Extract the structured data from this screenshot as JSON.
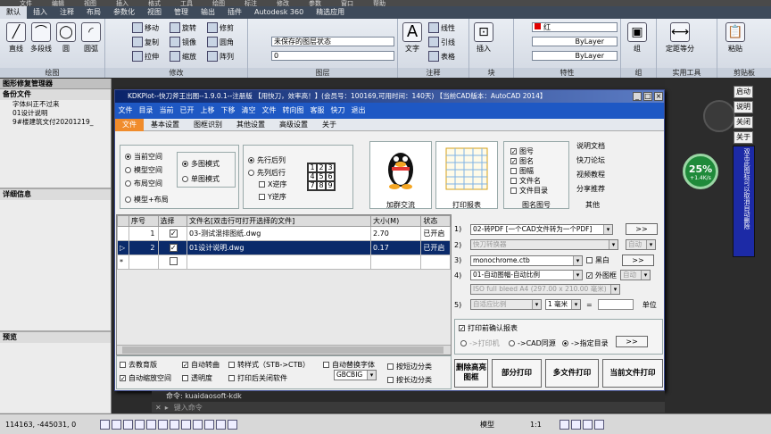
{
  "menubar": [
    "文件",
    "编辑",
    "视图",
    "插入",
    "格式",
    "工具",
    "绘图",
    "标注",
    "修改",
    "参数",
    "窗口",
    "帮助"
  ],
  "ribbon_tabs": [
    "默认",
    "插入",
    "注释",
    "布局",
    "参数化",
    "视图",
    "管理",
    "输出",
    "插件",
    "Autodesk 360",
    "精选应用"
  ],
  "ribbon": {
    "draw_group": "绘图",
    "modify_group": "修改",
    "layers_group": "图层",
    "annotate_group": "注释",
    "block_group": "块",
    "properties_group": "特性",
    "group_group": "组",
    "utility_group": "实用工具",
    "clipboard_group": "剪贴板",
    "line": "直线",
    "polyline": "多段线",
    "circle": "圆",
    "arc": "圆弧",
    "move": "移动",
    "rotate": "旋转",
    "trim": "修剪",
    "copy": "复制",
    "mirror": "镜像",
    "fillet": "圆角",
    "stretch": "拉伸",
    "scale": "缩放",
    "array": "阵列",
    "layer_state": "未保存的图层状态",
    "layer_current": "0",
    "text": "文字",
    "linear": "线性",
    "leader": "引线",
    "table": "表格",
    "insert": "插入",
    "color": "红",
    "bylayer1": "ByLayer",
    "bylayer2": "ByLayer",
    "group": "组",
    "measure": "定距等分",
    "paste": "粘贴"
  },
  "left_panel": {
    "title": "图形修复管理器",
    "backup_header": "备份文件",
    "items": [
      "字体纠正不过来",
      "01设计说明",
      "9#楼建筑文付20201219_"
    ],
    "details_header": "详细信息",
    "preview_header": "预览"
  },
  "dialog": {
    "title": "KDKPlot--快刀斧王出图--1.9.0.1--注册版 【用快刀，效率高！】(会员号：100169,可用时间：140天) 【当前CAD版本：AutoCAD 2014】",
    "menu": [
      "文件",
      "目录",
      "当前",
      "已开",
      "上移",
      "下移",
      "清空",
      "文件",
      "转向图",
      "客服",
      "快刀",
      "退出"
    ],
    "tabs": [
      "文件",
      "基本设置",
      "图框识别",
      "其他设置",
      "高级设置",
      "关于"
    ],
    "space": {
      "current": "当前空间",
      "model": "模型空间",
      "layout": "布局空间",
      "model_layout": "模型+布局"
    },
    "mode": {
      "multi": "多图模式",
      "single": "单图模式"
    },
    "order": {
      "first_row": "先行后列",
      "first_col": "先列后行",
      "x_rev": "X逆序",
      "y_rev": "Y逆序"
    },
    "grid": [
      "1",
      "2",
      "3",
      "4",
      "5",
      "6",
      "7",
      "8",
      "9"
    ],
    "qq_label": "加群交流",
    "print_label": "打印报表",
    "drawing_checks": [
      {
        "label": "图号",
        "checked": true
      },
      {
        "label": "图名",
        "checked": true
      },
      {
        "label": "图幅",
        "checked": false
      },
      {
        "label": "文件名",
        "checked": false
      },
      {
        "label": "文件目录",
        "checked": false
      }
    ],
    "drawing_group": "图名图号",
    "links": [
      "说明文档",
      "快刀论坛",
      "视频教程",
      "分享推荐"
    ],
    "links_group": "其他"
  },
  "table": {
    "headers": [
      "",
      "序号",
      "选择",
      "文件名[双击行可打开选择的文件]",
      "大小(M)",
      "状态"
    ],
    "rows": [
      {
        "marker": "",
        "no": "1",
        "checked": true,
        "name": "03-测试混排图纸.dwg",
        "size": "2.70",
        "status": "已开启"
      },
      {
        "marker": "▷",
        "no": "2",
        "checked": true,
        "name": "01设计说明.dwg",
        "size": "0.17",
        "status": "已开启"
      },
      {
        "marker": "*",
        "no": "",
        "checked": false,
        "name": "",
        "size": "",
        "status": ""
      }
    ]
  },
  "options": {
    "row1": {
      "num": "1)",
      "value": "02-转PDF [一个CAD文件转为一个PDF]",
      "btn": ">>"
    },
    "row2": {
      "num": "2)",
      "value": "快刀转换器",
      "side": "自动"
    },
    "row3": {
      "num": "3)",
      "value": "monochrome.ctb",
      "bw": "黑白",
      "btn": ">>"
    },
    "row4": {
      "num": "4)",
      "value": "01-自动图幅-自动比例",
      "frame": "外图框",
      "side": "自动"
    },
    "row4b": {
      "value": "ISO full bleed A4 (297.00 x 210.00 毫米)"
    },
    "row5": {
      "num": "5)",
      "value": "自适应比例",
      "mm1": "1",
      "mm": "毫米",
      "eq": "=",
      "unit": "单位"
    },
    "confirm": "打印前确认报表",
    "to_printer": "->打印机",
    "to_cad": "->CAD同源",
    "to_dir": "->指定目录",
    "btn": ">>"
  },
  "bottom_checks": [
    {
      "label": "去教育版",
      "checked": false
    },
    {
      "label": "自动转曲",
      "checked": true
    },
    {
      "label": "转样式（STB->CTB）",
      "checked": false
    },
    {
      "label": "自动替换字体",
      "checked": false
    },
    {
      "label": "按短边分类",
      "checked": false
    },
    {
      "label": "自动缩放空间",
      "checked": true
    },
    {
      "label": "透明度",
      "checked": false
    },
    {
      "label": "打印后关闭软件",
      "checked": false
    },
    {
      "label": "按长边分类",
      "checked": false
    }
  ],
  "encoding": "GBCBIG",
  "buttons": {
    "delete_frames": "删除高亮图框",
    "partial": "部分打印",
    "multi": "多文件打印",
    "current": "当前文件打印"
  },
  "side_buttons": [
    "启动",
    "说明",
    "关闭",
    "关于"
  ],
  "blue_text": "双击此图标可以取消自动删除",
  "badge": {
    "percent": "25%",
    "speed": "+1.4K/s"
  },
  "command": {
    "line1": "命令: kuaidaosoft-kdk",
    "prompt": "键入命令"
  },
  "status": {
    "coords": "114163, -445031, 0",
    "model": "模型",
    "scale": "1:1"
  }
}
